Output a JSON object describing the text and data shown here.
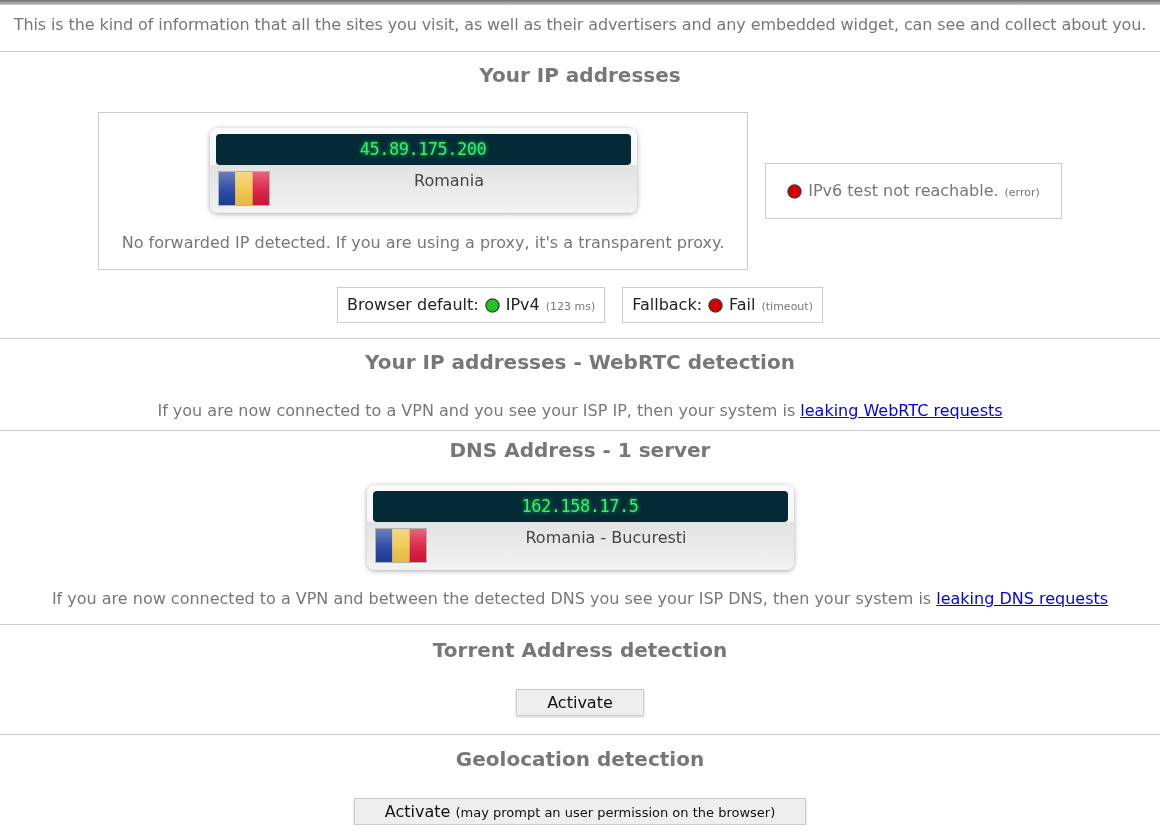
{
  "top_notice": "This is the kind of information that all the sites you visit, as well as their advertisers and any embedded widget, can see and collect about you.",
  "ip_addresses": {
    "heading": "Your IP addresses",
    "ip_cards": [
      {
        "ip": "45.89.175.200",
        "location": "Romania"
      }
    ],
    "note": "No forwarded IP detected. If you are using a proxy, it's a transparent proxy.",
    "ipv6": {
      "color": "#d40000",
      "text": "IPv6 test not reachable.",
      "detail": "(error)"
    },
    "checks": [
      {
        "label": "Browser default:",
        "color": "#1ec81e",
        "value": "IPv4",
        "detail": "(123 ms)"
      },
      {
        "label": "Fallback:",
        "color": "#d40000",
        "value": "Fail",
        "detail": "(timeout)"
      }
    ]
  },
  "webrtc": {
    "heading": "Your IP addresses - WebRTC detection",
    "text": "If you are now connected to a VPN and you see your ISP IP, then your system is ",
    "link": "leaking WebRTC requests"
  },
  "dns": {
    "heading": "DNS Address - 1 server",
    "dns_cards": [
      {
        "ip": "162.158.17.5",
        "location": "Romania - Bucuresti"
      }
    ],
    "text": "If you are now connected to a VPN and between the detected DNS you see your ISP DNS, then your system is ",
    "link": "leaking DNS requests"
  },
  "torrent": {
    "heading": "Torrent Address detection",
    "button": {
      "label": "Activate"
    }
  },
  "geolocation": {
    "heading": "Geolocation detection",
    "button": {
      "label": "Activate",
      "note": "(may prompt an user permission on the browser)"
    }
  }
}
